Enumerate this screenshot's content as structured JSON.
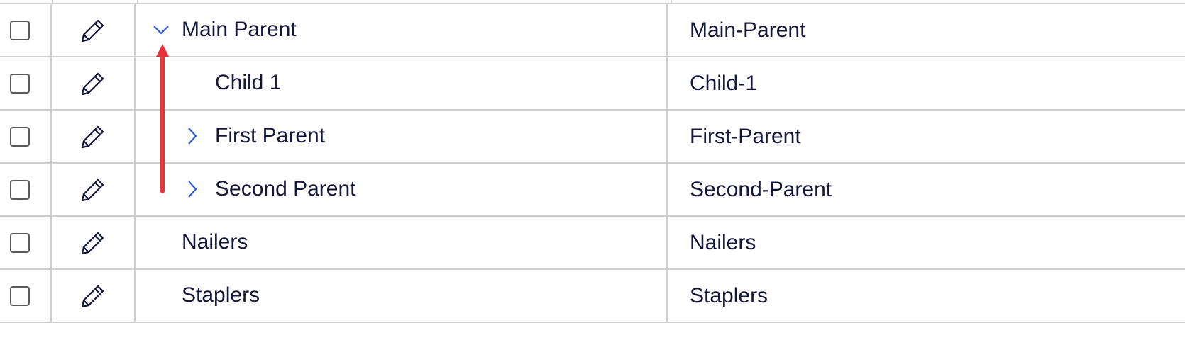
{
  "table": {
    "rows": [
      {
        "name": "Main Parent",
        "code": "Main-Parent",
        "level": 0,
        "toggle": "expanded",
        "toggle_icon": "chevron-down-icon"
      },
      {
        "name": "Child 1",
        "code": "Child-1",
        "level": 1,
        "toggle": "none",
        "toggle_icon": ""
      },
      {
        "name": "First Parent",
        "code": "First-Parent",
        "level": 1,
        "toggle": "collapsed",
        "toggle_icon": "chevron-right-icon"
      },
      {
        "name": "Second Parent",
        "code": "Second-Parent",
        "level": 1,
        "toggle": "collapsed",
        "toggle_icon": "chevron-right-icon"
      },
      {
        "name": "Nailers",
        "code": "Nailers",
        "level": 0,
        "toggle": "none",
        "toggle_icon": ""
      },
      {
        "name": "Staplers",
        "code": "Staplers",
        "level": 0,
        "toggle": "none",
        "toggle_icon": ""
      }
    ]
  },
  "icons": {
    "row_checkbox": "checkbox",
    "row_edit": "pencil-icon"
  },
  "colors": {
    "text": "#14173a",
    "grid_line": "#cfcfcf",
    "toggle_accent": "#2d5be3",
    "annotation_arrow": "#e8333a",
    "checkbox_border": "#5b5b5b"
  }
}
